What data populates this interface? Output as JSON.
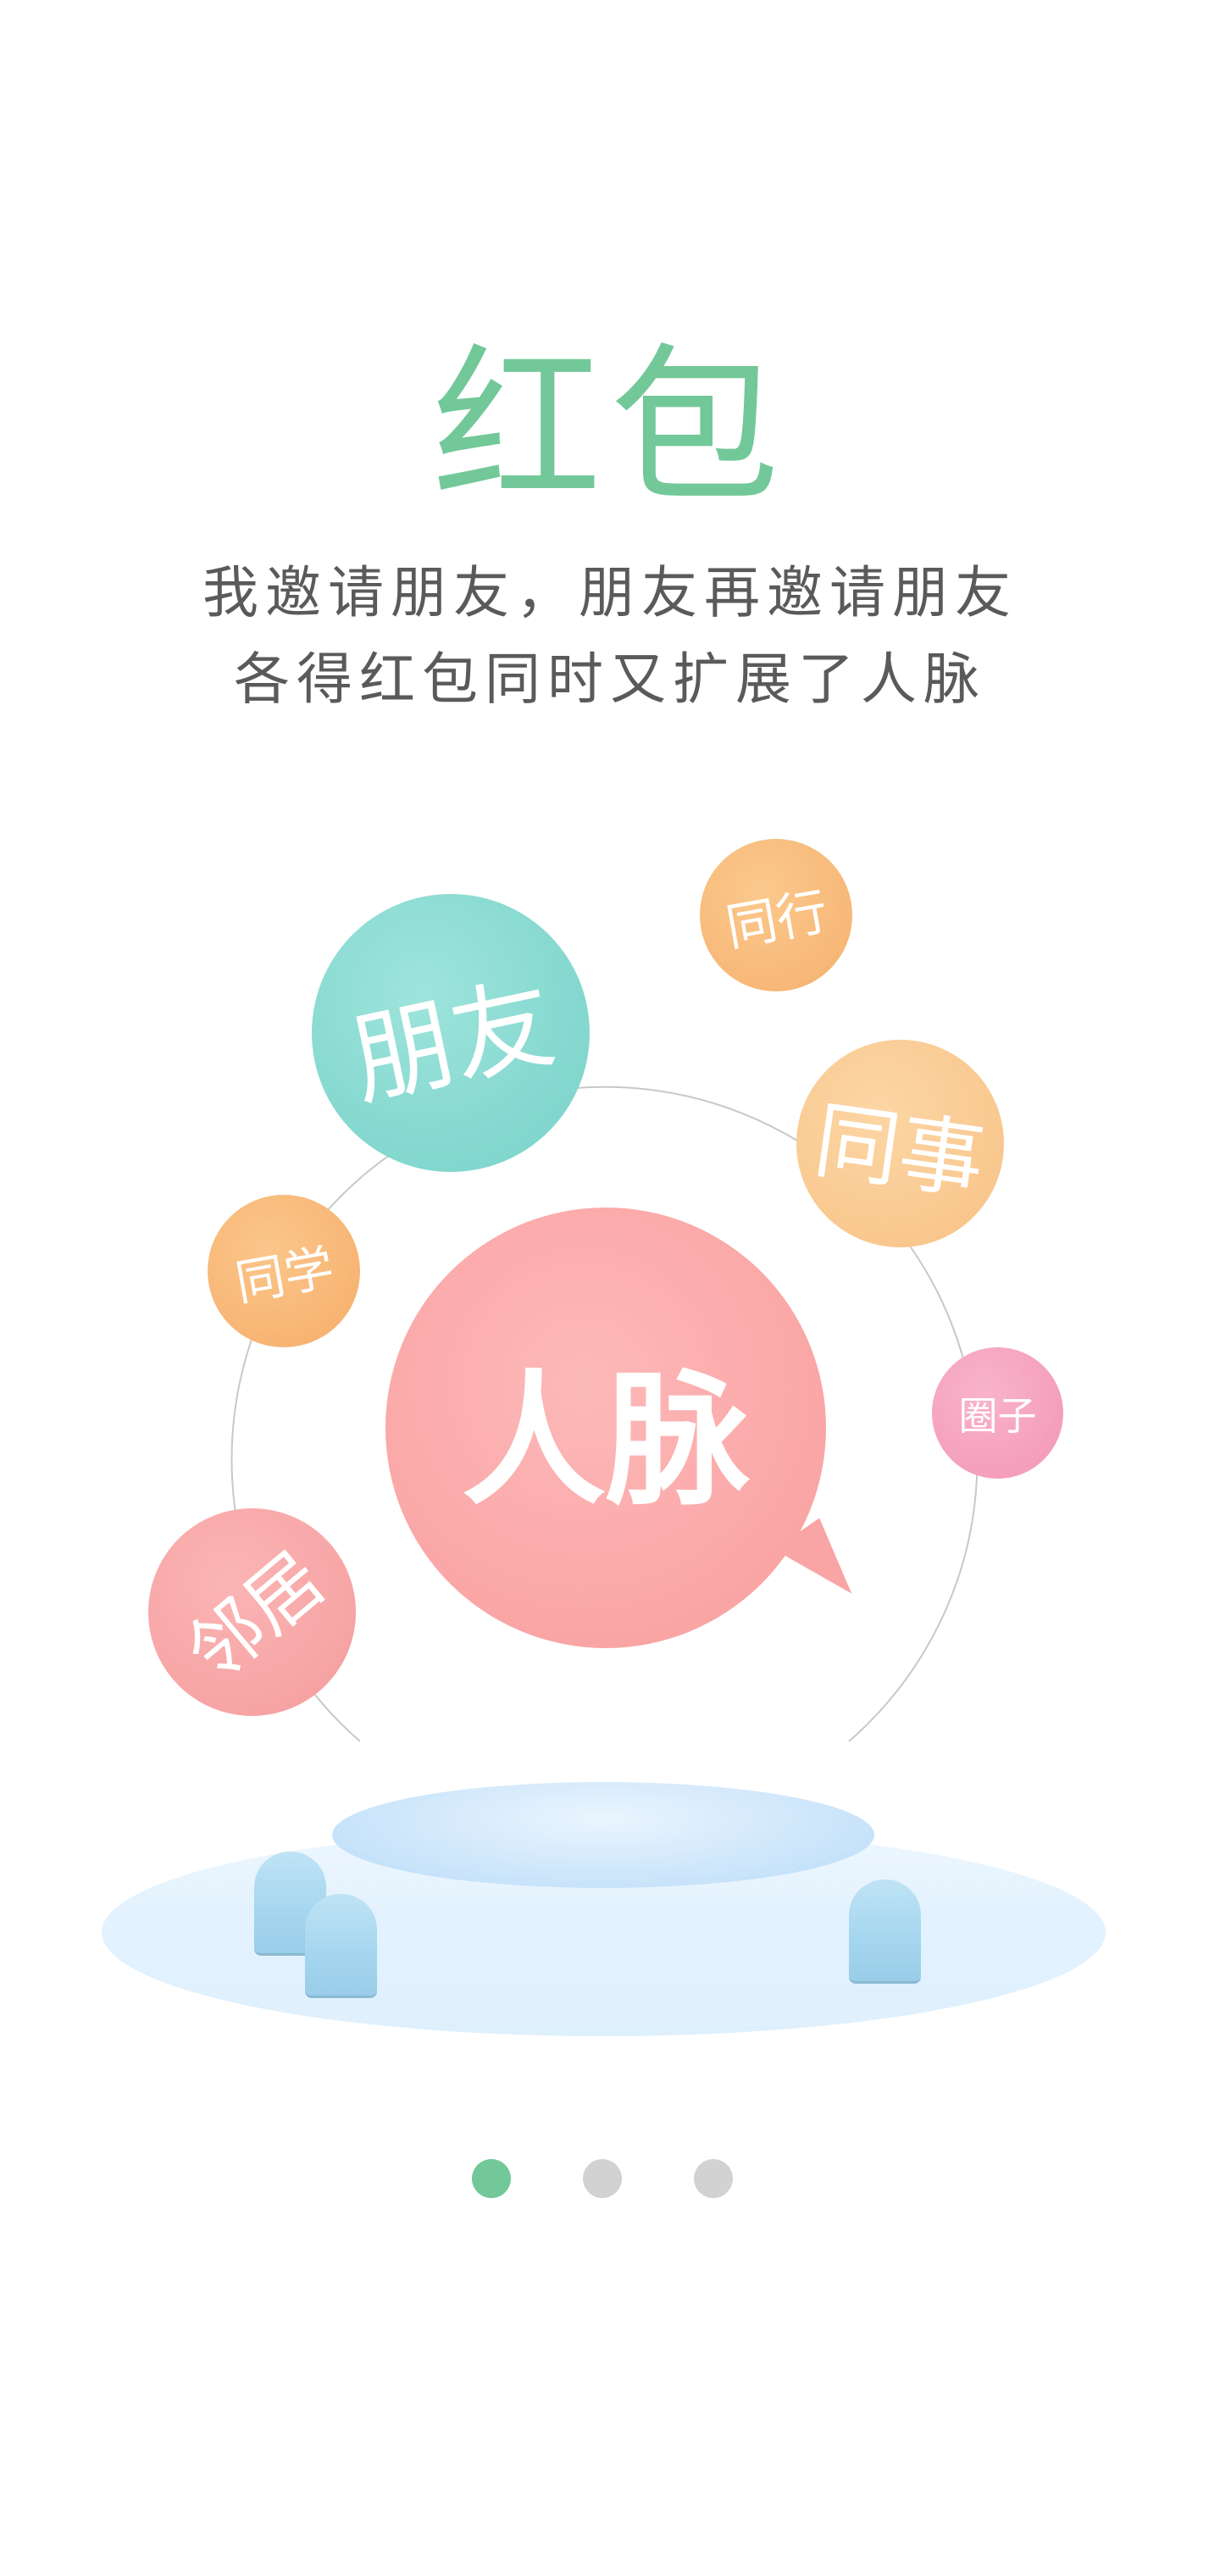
{
  "title": "红包",
  "subtitle": {
    "line1": "我邀请朋友，朋友再邀请朋友",
    "line2": "各得红包同时又扩展了人脉"
  },
  "bubbles": {
    "center": "人脉",
    "friend": "朋友",
    "peer": "同行",
    "colleague": "同事",
    "classmate": "同学",
    "circle": "圈子",
    "neighbor": "邻居"
  },
  "colors": {
    "accent": "#72c898",
    "text": "#5a5a5a",
    "friend": "#86d9d0",
    "peer": "#f7b878",
    "colleague": "#f9c88f",
    "classmate": "#f7b574",
    "center": "#fba8a8",
    "circle": "#f49fbb",
    "neighbor": "#f7a4a4",
    "dot_inactive": "#d2d2d2"
  },
  "pager": {
    "total": 3,
    "active_index": 0
  }
}
